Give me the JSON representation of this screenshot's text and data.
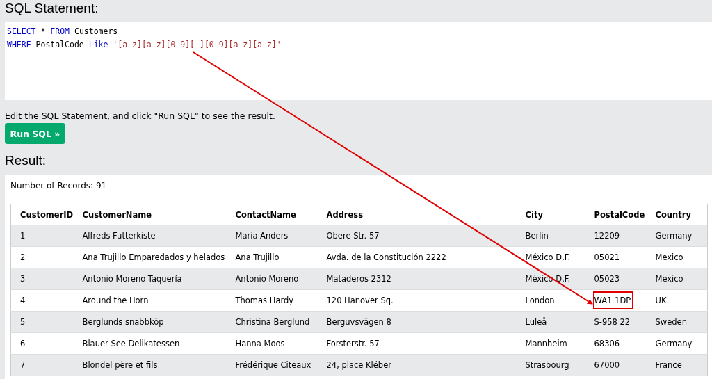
{
  "editor": {
    "heading": "SQL Statement:",
    "lines": [
      [
        {
          "kind": "keyword",
          "text": "SELECT"
        },
        {
          "kind": "plain",
          "text": " * "
        },
        {
          "kind": "keyword",
          "text": "FROM"
        },
        {
          "kind": "plain",
          "text": " Customers"
        }
      ],
      [
        {
          "kind": "keyword",
          "text": "WHERE"
        },
        {
          "kind": "plain",
          "text": " PostalCode "
        },
        {
          "kind": "keyword",
          "text": "Like"
        },
        {
          "kind": "string",
          "text": " '[a-z][a-z][0-9][ ][0-9][a-z][a-z]'"
        }
      ]
    ],
    "hint": "Edit the SQL Statement, and click \"Run SQL\" to see the result.",
    "run_button": "Run SQL »"
  },
  "result": {
    "heading": "Result:",
    "record_count": "Number of Records: 91",
    "columns": [
      "CustomerID",
      "CustomerName",
      "ContactName",
      "Address",
      "City",
      "PostalCode",
      "Country"
    ],
    "rows": [
      {
        "cells": [
          "1",
          "Alfreds Futterkiste",
          "Maria Anders",
          "Obere Str. 57",
          "Berlin",
          "12209",
          "Germany"
        ],
        "postal_marked": false
      },
      {
        "cells": [
          "2",
          "Ana Trujillo Emparedados y helados",
          "Ana Trujillo",
          "Avda. de la Constitución 2222",
          "México D.F.",
          "05021",
          "Mexico"
        ],
        "postal_marked": false
      },
      {
        "cells": [
          "3",
          "Antonio Moreno Taquería",
          "Antonio Moreno",
          "Mataderos 2312",
          "México D.F.",
          "05023",
          "Mexico"
        ],
        "postal_marked": false
      },
      {
        "cells": [
          "4",
          "Around the Horn",
          "Thomas Hardy",
          "120 Hanover Sq.",
          "London",
          "WA1 1DP",
          "UK"
        ],
        "postal_marked": true
      },
      {
        "cells": [
          "5",
          "Berglunds snabbköp",
          "Christina Berglund",
          "Berguvsvägen 8",
          "Luleå",
          "S-958 22",
          "Sweden"
        ],
        "postal_marked": false
      },
      {
        "cells": [
          "6",
          "Blauer See Delikatessen",
          "Hanna Moos",
          "Forsterstr. 57",
          "Mannheim",
          "68306",
          "Germany"
        ],
        "postal_marked": false
      },
      {
        "cells": [
          "7",
          "Blondel père et fils",
          "Frédérique Citeaux",
          "24, place Kléber",
          "Strasbourg",
          "67000",
          "France"
        ],
        "postal_marked": false
      }
    ]
  }
}
